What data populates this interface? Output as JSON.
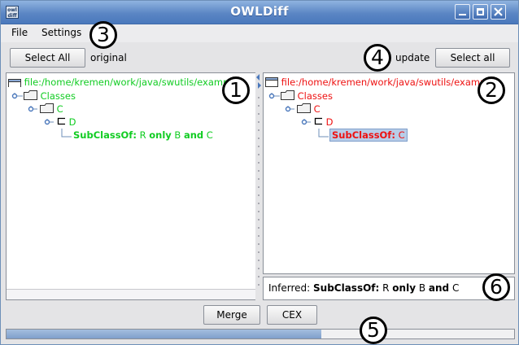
{
  "window": {
    "title": "OWLDiff",
    "icon": "owldiff-app-icon",
    "icon_text_top": "owl",
    "icon_text_bottom": "diff"
  },
  "menu": {
    "file": "File",
    "settings": "Settings"
  },
  "toolbar": {
    "select_all_left": "Select All",
    "original_label": "original",
    "update_label": "update",
    "select_all_right": "Select all"
  },
  "left_tree": {
    "root": "file:/home/kremen/work/java/swutils/example",
    "classes": "Classes",
    "class_c": "C",
    "class_d": "D",
    "axiom_keyword": "SubClassOf:",
    "axiom_rest_1": " R ",
    "axiom_only": "only",
    "axiom_rest_2": " B ",
    "axiom_and": "and",
    "axiom_rest_3": " C"
  },
  "right_tree": {
    "root": "file:/home/kremen/work/java/swutils/example",
    "classes": "Classes",
    "class_c": "C",
    "class_d": "D",
    "axiom_keyword": "SubClassOf:",
    "axiom_rest": " C"
  },
  "inferred": {
    "prefix": "Inferred: ",
    "keyword": "SubClassOf:",
    "rest_1": " R ",
    "only": "only",
    "rest_2": " B ",
    "and": "and",
    "rest_3": " C"
  },
  "actions": {
    "merge": "Merge",
    "cex": "CEX"
  },
  "progress": {
    "fraction": 0.62
  },
  "callouts": [
    "1",
    "2",
    "3",
    "4",
    "5",
    "6"
  ],
  "colors": {
    "left_tree_text": "#11cc22",
    "right_tree_text": "#ee1111",
    "titlebar": "#5b86c4",
    "selection": "#b8cde8"
  }
}
